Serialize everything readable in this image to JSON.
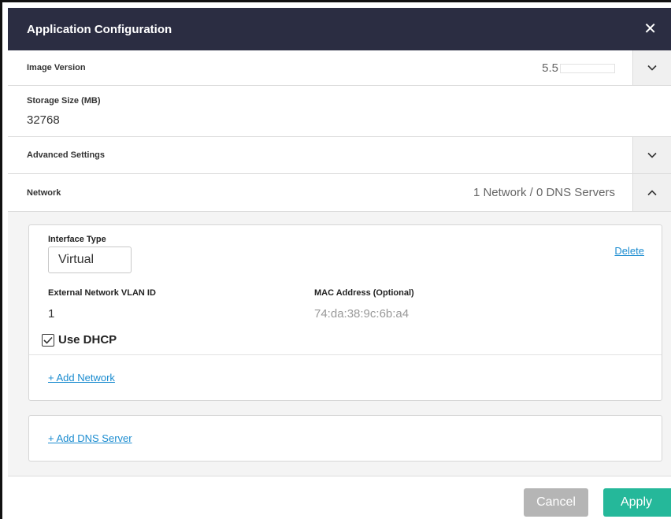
{
  "dialog": {
    "title": "Application Configuration"
  },
  "image_version": {
    "label": "Image Version",
    "value": "5.5"
  },
  "storage": {
    "label": "Storage Size (MB)",
    "value": "32768"
  },
  "advanced": {
    "label": "Advanced Settings"
  },
  "network": {
    "label": "Network",
    "summary": "1 Network / 0 DNS Servers",
    "interface_type_label": "Interface Type",
    "interface_type_value": "Virtual",
    "delete_label": "Delete",
    "vlan_label": "External Network VLAN ID",
    "vlan_value": "1",
    "mac_label": "MAC Address (Optional)",
    "mac_placeholder": "74:da:38:9c:6b:a4",
    "dhcp_label": "Use DHCP",
    "dhcp_checked": true,
    "add_network_label": "+ Add Network",
    "add_dns_label": "+ Add DNS Server"
  },
  "footer": {
    "cancel_label": "Cancel",
    "apply_label": "Apply"
  },
  "colors": {
    "header_bg": "#2b2d42",
    "link": "#1b8cd0",
    "apply": "#25b89a",
    "cancel": "#b5b5b5"
  },
  "icons": {
    "close": "close-icon",
    "chevron_down": "chevron-down-icon",
    "chevron_up": "chevron-up-icon",
    "check": "check-icon"
  }
}
